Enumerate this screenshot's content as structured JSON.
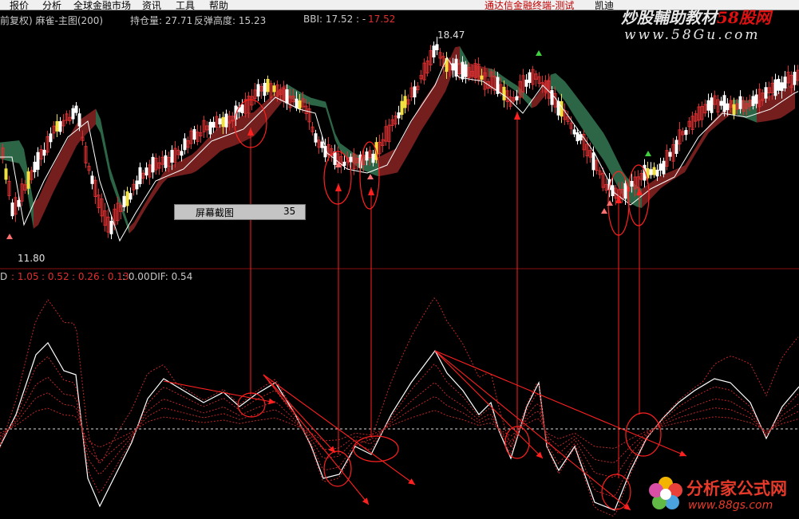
{
  "menu": [
    "报价",
    "分析",
    "全球金融市场",
    "资讯",
    "工具",
    "帮助"
  ],
  "window_title": "通达信金融终端-测试",
  "window_title_extra": "凯迪",
  "header": {
    "chart_label": "前复权) 麻雀-主图(200)",
    "holding": "持仓量: 27.71",
    "rebound": "反弹高度: 15.23",
    "bbi_label": "BBI: 17.52 : -",
    "bbi_red": "17.52"
  },
  "watermark": {
    "main_a": "炒股輔助教材",
    "main_b": "58股网",
    "url": "www.58Gu.com"
  },
  "popup": {
    "label": "屏幕截图",
    "value": "35"
  },
  "price_labels": {
    "high": "18.47",
    "low": "11.80"
  },
  "indicator": {
    "prefix": "D",
    "v1": ": 1.05",
    "v2": ": 0.52",
    "v3": ": 0.26",
    "v4": ": 0.13",
    "v5": ": 0.00",
    "dif": "DIF: 0.54"
  },
  "logo": {
    "text": "分析家公式网",
    "url": "www.88gs.com"
  },
  "colors": {
    "up": "#d83030",
    "down": "#ffffff",
    "yellow": "#f0e040",
    "green_band": "#2f6b4a",
    "red_band": "#7a2020",
    "accent_red": "#ff2020"
  }
}
